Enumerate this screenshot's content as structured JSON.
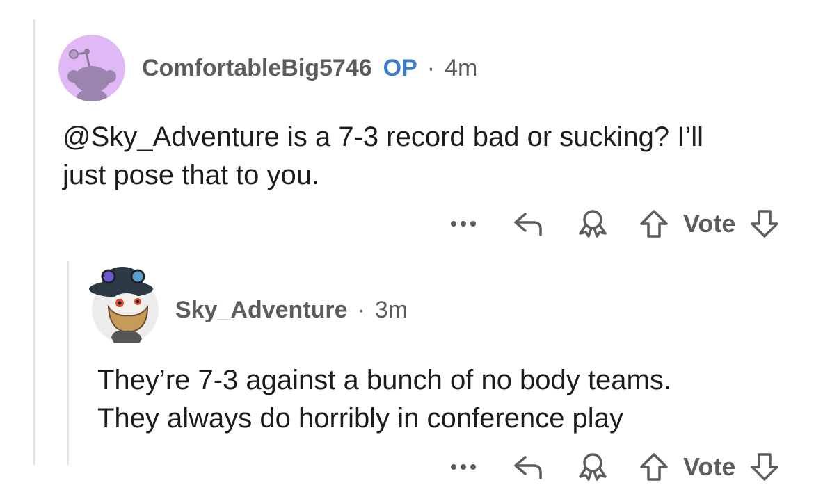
{
  "comments": [
    {
      "username": "ComfortableBig5746",
      "op_badge": "OP",
      "separator": "·",
      "timestamp": "4m",
      "body_line1": "@Sky_Adventure is a 7-3 record bad or sucking? I’ll",
      "body_line2": "just pose that to you.",
      "avatar_color": "#e0b8f5",
      "avatar_icon": "snoo-avatar-icon",
      "actions": {
        "more_icon": "more-horizontal-icon",
        "reply_icon": "reply-icon",
        "award_icon": "award-icon",
        "upvote_icon": "upvote-icon",
        "vote_label": "Vote",
        "downvote_icon": "downvote-icon"
      }
    },
    {
      "username": "Sky_Adventure",
      "separator": "·",
      "timestamp": "3m",
      "body_line1": "They’re 7-3 against a bunch of no body teams.",
      "body_line2": "They always do horribly in conference play",
      "avatar_color": "#ececec",
      "avatar_icon": "custom-avatar-icon",
      "actions": {
        "more_icon": "more-horizontal-icon",
        "reply_icon": "reply-icon",
        "award_icon": "award-icon",
        "upvote_icon": "upvote-icon",
        "vote_label": "Vote",
        "downvote_icon": "downvote-icon"
      }
    }
  ],
  "colors": {
    "text_primary": "#1c1c1c",
    "text_meta": "#5c5c5c",
    "op_badge": "#3d7cc9",
    "thread_line": "#e5e5e5",
    "icon": "#5c5c5c"
  }
}
